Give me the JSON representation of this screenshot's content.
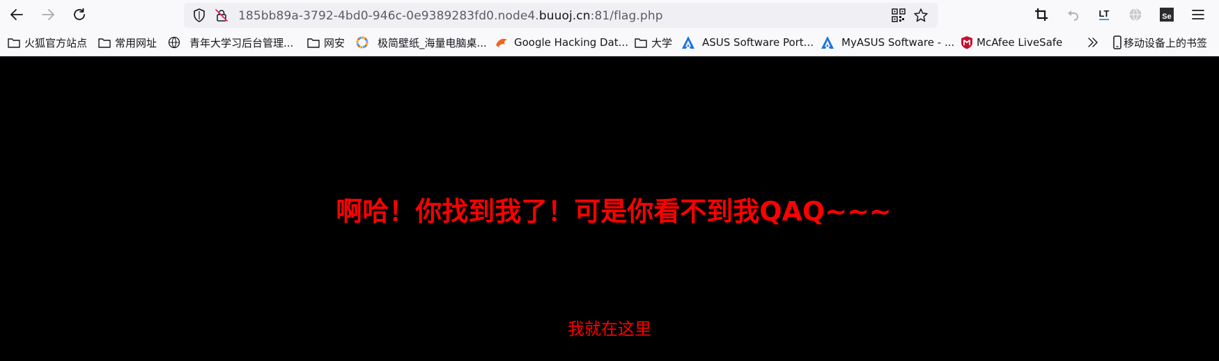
{
  "browser": {
    "url": {
      "prefix": "185bb89a-3792-4bd0-946c-0e9389283fd0.node4.",
      "domain": "buuoj.cn",
      "suffix": ":81/flag.php"
    },
    "icons": {
      "back": "back-arrow-icon",
      "forward": "forward-arrow-icon",
      "reload": "reload-icon",
      "shield": "tracking-protection-shield-icon",
      "insecure": "insecure-lock-icon",
      "qr": "qr-code-icon",
      "bookmark_star": "bookmark-star-icon",
      "crop": "screenshot-crop-icon",
      "undo": "undo-icon",
      "ext_lt": "translate-extension-icon",
      "globe": "globe-extension-icon",
      "se": "selenium-extension-icon",
      "menu": "hamburger-menu-icon"
    },
    "ext_labels": {
      "lt": "LT",
      "se": "Se"
    }
  },
  "bookmarks": [
    {
      "label": "火狐官方站点",
      "icon": "folder-icon"
    },
    {
      "label": "常用网址",
      "icon": "folder-icon"
    },
    {
      "label": "青年大学习后台管理...",
      "icon": "globe-icon"
    },
    {
      "label": "网安",
      "icon": "folder-icon"
    },
    {
      "label": "极简壁纸_海量电脑桌...",
      "icon": "wallpaper-site-icon"
    },
    {
      "label": "Google Hacking Dat...",
      "icon": "exploit-db-icon"
    },
    {
      "label": "大学",
      "icon": "folder-icon"
    },
    {
      "label": "ASUS Software Port...",
      "icon": "asus-icon"
    },
    {
      "label": "MyASUS Software - ...",
      "icon": "asus-icon"
    },
    {
      "label": "McAfee LiveSafe",
      "icon": "mcafee-icon"
    }
  ],
  "bookmarks_overflow": {
    "label": "",
    "icon": "chevron-double-right-icon"
  },
  "mobile_bookmarks": {
    "label": "移动设备上的书签",
    "icon": "mobile-device-icon"
  },
  "page": {
    "headline": "啊哈！你找到我了！可是你看不到我QAQ~~~",
    "subtext": "我就在这里",
    "colors": {
      "background": "#000000",
      "text": "#ff0000"
    }
  }
}
